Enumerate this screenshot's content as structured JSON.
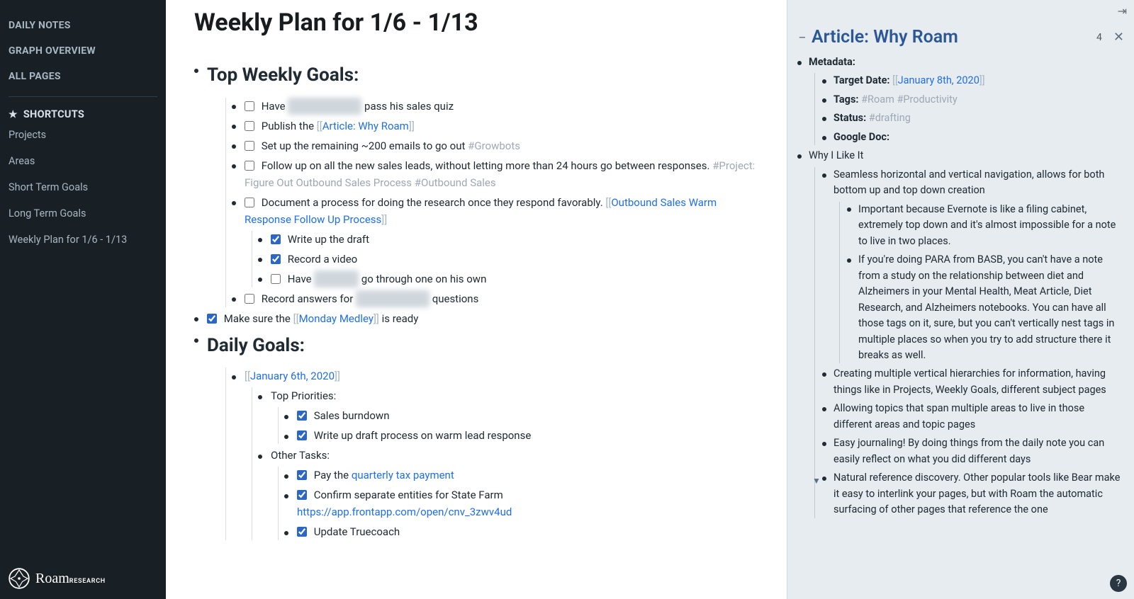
{
  "sidebar": {
    "nav": [
      "DAILY NOTES",
      "GRAPH OVERVIEW",
      "ALL PAGES"
    ],
    "shortcuts_header": "SHORTCUTS",
    "shortcuts": [
      "Projects",
      "Areas",
      "Short Term Goals",
      "Long Term Goals",
      "Weekly Plan for 1/6 - 1/13"
    ],
    "brand": "Roam",
    "brand_sub": "RESEARCH"
  },
  "page": {
    "title": "Weekly Plan for 1/6 - 1/13",
    "sections": {
      "top_goals_title": "Top Weekly Goals:",
      "daily_goals_title": "Daily Goals:"
    },
    "goals": {
      "g1_pre": "Have ",
      "g1_blur": "redacted name",
      "g1_post": " pass his sales quiz",
      "g2_pre": "Publish the ",
      "g2_link": "Article: Why Roam",
      "g3_text": "Set up the remaining ~200 emails to go out ",
      "g3_tag": "#Growbots",
      "g4_text": "Follow up on all the new sales leads, without letting more than 24 hours go between responses. ",
      "g4_tag1": "#Project: Figure Out Outbound Sales Process",
      "g4_tag2": "#Outbound Sales",
      "g5_text": "Document a process for doing the research once they respond favorably. ",
      "g5_link": "Outbound Sales Warm Response Follow Up Process",
      "g5_c1": "Write up the draft",
      "g5_c2": "Record a video",
      "g5_c3_pre": "Have ",
      "g5_c3_blur": "redacted",
      "g5_c3_post": " go through one on his own",
      "g6_pre": "Record answers for ",
      "g6_blur": "redacted name",
      "g6_post": " questions",
      "ready_pre": "Make sure the ",
      "ready_link": "Monday Medley",
      "ready_post": " is ready"
    },
    "daily": {
      "date_link": "January 6th, 2020",
      "top_priorities_label": "Top Priorities:",
      "other_tasks_label": "Other Tasks:",
      "tp1": "Sales burndown",
      "tp2": "Write up draft process on warm lead response",
      "ot1_pre": "Pay the ",
      "ot1_link": "quarterly tax payment",
      "ot2_text": "Confirm separate entities for State Farm ",
      "ot2_url": "https://app.frontapp.com/open/cnv_3zwv4ud",
      "ot3": "Update Truecoach"
    }
  },
  "right": {
    "title": "Article: Why Roam",
    "count": "4",
    "metadata": {
      "heading": "Metadata:",
      "target_date_label": "Target Date: ",
      "target_date_link": "January 8th, 2020",
      "tags_label": "Tags: ",
      "tags_val": "#Roam #Productivity",
      "status_label": "Status: ",
      "status_val": "#drafting",
      "google_doc_label": "Google Doc:"
    },
    "why_heading": "Why I Like It",
    "reasons": {
      "r1": "Seamless horizontal and vertical navigation, allows for both bottom up and top down creation",
      "r1a": "Important because Evernote is like a filing cabinet, extremely top down and it's almost impossible for a note to live in two places.",
      "r1b": "If you're doing PARA from BASB, you can't have a note from a study on the relationship between diet and Alzheimers in your Mental Health, Meat Article, Diet Research, and Alzheimers notebooks. You can have all those tags on it, sure, but you can't vertically nest tags in multiple places so when you try to add structure there it breaks as well.",
      "r2": "Creating multiple vertical hierarchies for information, having things like in Projects, Weekly Goals, different subject pages",
      "r3": "Allowing topics that span multiple areas to live in those different areas and topic pages",
      "r4": "Easy journaling! By doing things from the daily note you can easily reflect on what you did different days",
      "r5": "Natural reference discovery. Other popular tools like Bear make it easy to interlink your pages, but with Roam the automatic surfacing of other pages that reference the one"
    }
  }
}
